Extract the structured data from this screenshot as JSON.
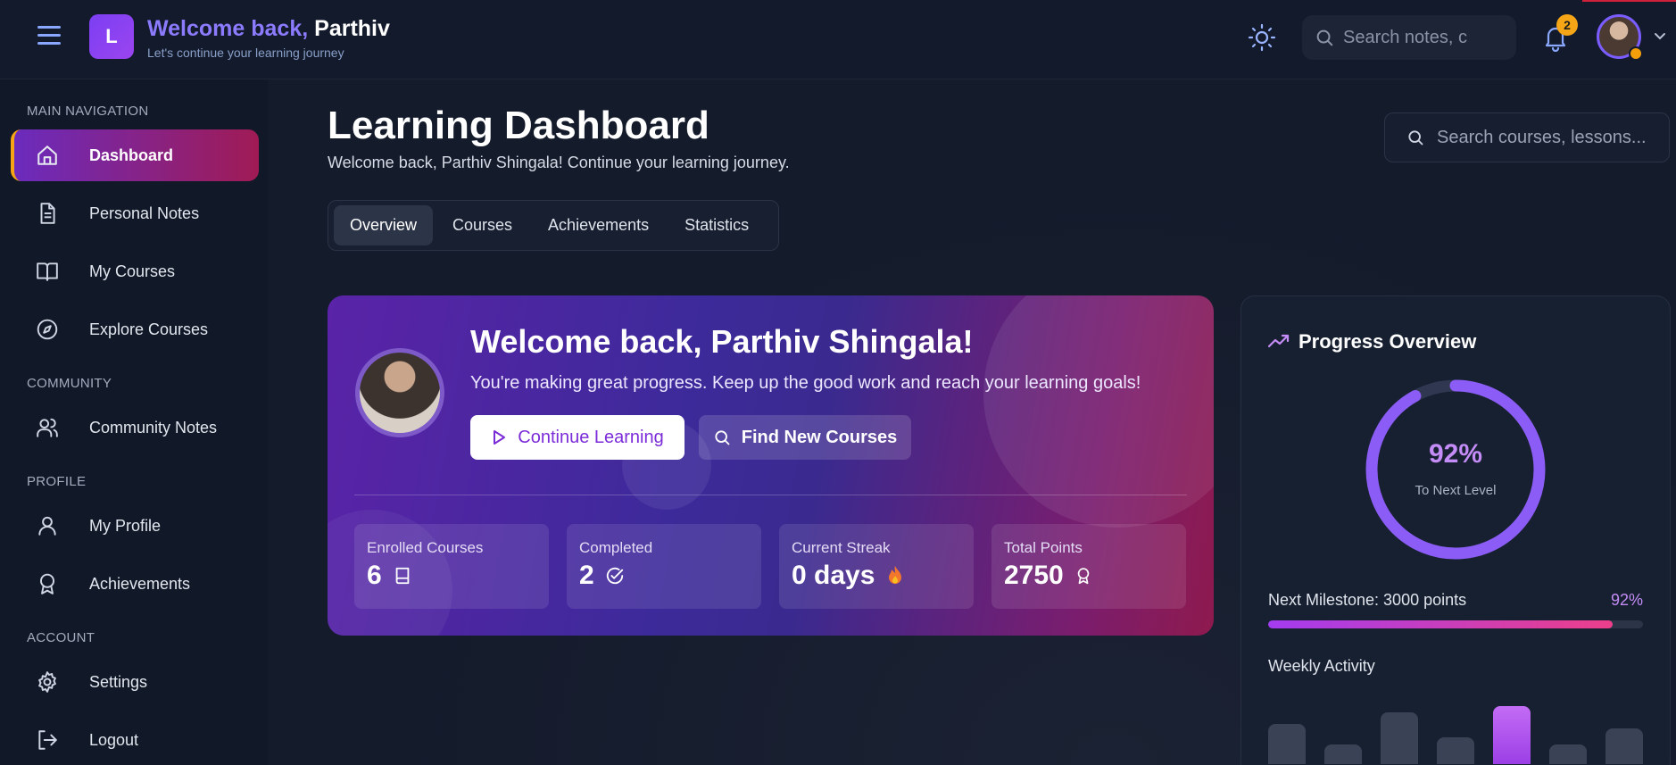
{
  "header": {
    "logo_letter": "L",
    "greeting_prefix": "Welcome back,",
    "greeting_name": "Parthiv",
    "subtitle": "Let's continue your learning journey",
    "search_placeholder": "Search notes, c",
    "notification_count": "2"
  },
  "sidebar": {
    "sections": {
      "main": "MAIN NAVIGATION",
      "community": "COMMUNITY",
      "profile": "PROFILE",
      "account": "ACCOUNT"
    },
    "items": [
      {
        "label": "Dashboard",
        "icon": "home-icon",
        "active": true
      },
      {
        "label": "Personal Notes",
        "icon": "document-icon"
      },
      {
        "label": "My Courses",
        "icon": "book-open-icon"
      },
      {
        "label": "Explore Courses",
        "icon": "compass-icon"
      },
      {
        "label": "Community Notes",
        "icon": "users-icon"
      },
      {
        "label": "My Profile",
        "icon": "user-icon"
      },
      {
        "label": "Achievements",
        "icon": "award-icon"
      },
      {
        "label": "Settings",
        "icon": "gear-icon"
      },
      {
        "label": "Logout",
        "icon": "logout-icon"
      }
    ]
  },
  "main": {
    "title": "Learning Dashboard",
    "subtitle": "Welcome back, Parthiv Shingala! Continue your learning journey.",
    "search_placeholder": "Search courses, lessons...",
    "tabs": [
      {
        "label": "Overview",
        "active": true
      },
      {
        "label": "Courses"
      },
      {
        "label": "Achievements"
      },
      {
        "label": "Statistics"
      }
    ]
  },
  "hero": {
    "title": "Welcome back, Parthiv Shingala!",
    "subtitle": "You're making great progress. Keep up the good work and reach your learning goals!",
    "continue_label": "Continue Learning",
    "find_label": "Find New Courses",
    "stats": [
      {
        "label": "Enrolled Courses",
        "value": "6",
        "icon": "book-icon"
      },
      {
        "label": "Completed",
        "value": "2",
        "icon": "check-circle-icon"
      },
      {
        "label": "Current Streak",
        "value": "0 days",
        "icon": "flame-icon"
      },
      {
        "label": "Total Points",
        "value": "2750",
        "icon": "award-icon"
      }
    ]
  },
  "progress": {
    "title": "Progress Overview",
    "ring_value": 92,
    "ring_pct_text": "92%",
    "ring_label": "To Next Level",
    "milestone_label": "Next Milestone: 3000 points",
    "milestone_pct_text": "92%",
    "milestone_value": 92,
    "weekly_label": "Weekly Activity",
    "weekly_levels": [
      0.63,
      0.3,
      0.8,
      0.42,
      0.9,
      0.3,
      0.55
    ],
    "weekly_highlight_index": 4
  },
  "colors": {
    "accent": "#7b3ff2",
    "active_nav_start": "#6b2bbd",
    "active_nav_end": "#a01b55",
    "badge": "#f5a516",
    "ring": "#8b5cf6"
  }
}
